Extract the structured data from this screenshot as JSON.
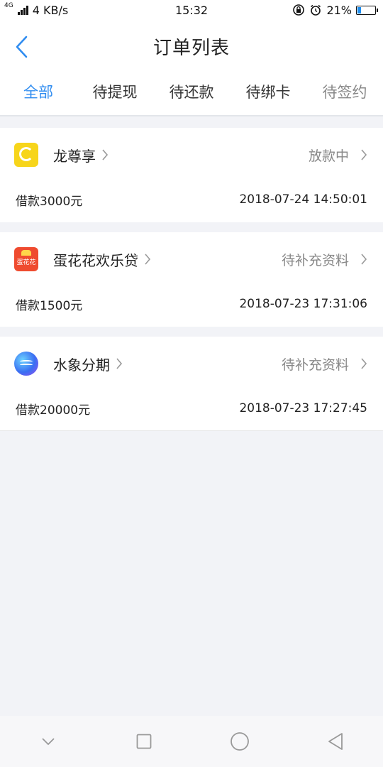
{
  "status_bar": {
    "network": "4G",
    "speed": "4 KB/s",
    "time": "15:32",
    "battery": "21%",
    "battery_level": 0.21
  },
  "header": {
    "title": "订单列表"
  },
  "tabs": [
    {
      "label": "全部",
      "active": true
    },
    {
      "label": "待提现",
      "active": false
    },
    {
      "label": "待还款",
      "active": false
    },
    {
      "label": "待绑卡",
      "active": false
    },
    {
      "label": "待签约",
      "active": false
    }
  ],
  "orders": [
    {
      "name": "龙尊享",
      "status": "放款中",
      "amount": "借款3000元",
      "datetime": "2018-07-24 14:50:01",
      "logo": "dragon-logo-icon"
    },
    {
      "name": "蛋花花欢乐贷",
      "status": "待补充资料",
      "amount": "借款1500元",
      "datetime": "2018-07-23 17:31:06",
      "logo": "danhuahua-logo-icon",
      "logo_text": "蛋花花"
    },
    {
      "name": "水象分期",
      "status": "待补充资料",
      "amount": "借款20000元",
      "datetime": "2018-07-23 17:27:45",
      "logo": "shuixiang-logo-icon"
    }
  ],
  "colors": {
    "accent": "#2f8cf0",
    "background": "#f2f3f7"
  }
}
